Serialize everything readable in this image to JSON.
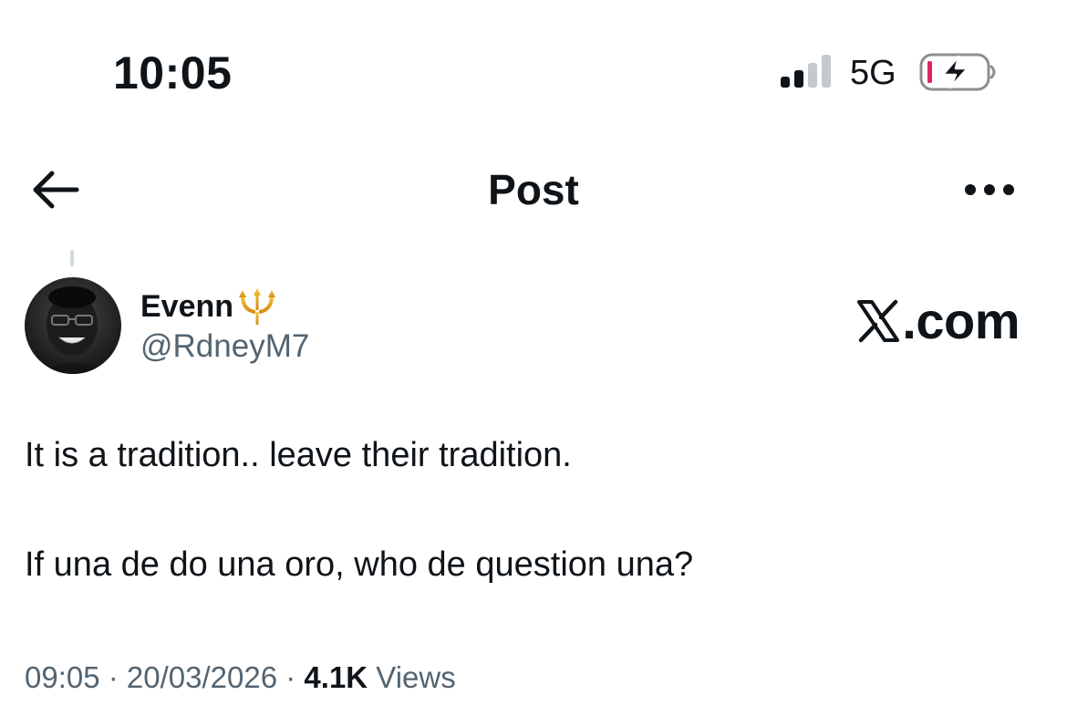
{
  "status_bar": {
    "time": "10:05",
    "network": "5G"
  },
  "header": {
    "title": "Post"
  },
  "author": {
    "name": "Evenn",
    "handle": "@RdneyM7"
  },
  "watermark": ".com",
  "post": {
    "line1": "It is a tradition.. leave their tradition.",
    "line2": "If una de do una oro, who de question una?"
  },
  "meta": {
    "time": "09:05",
    "date": "20/03/2026",
    "separator": " · ",
    "views_count": "4.1K",
    "views_label": " Views"
  },
  "icons": {
    "back": "back-arrow-icon",
    "more": "more-horizontal-icon",
    "signal": "signal-icon",
    "battery": "battery-charging-icon",
    "emoji": "trident-emoji",
    "logo": "x-logo-icon"
  },
  "colors": {
    "text": "#0f1419",
    "secondary": "#536471",
    "battery_low": "#e0245e",
    "trident": "#e8a317"
  }
}
